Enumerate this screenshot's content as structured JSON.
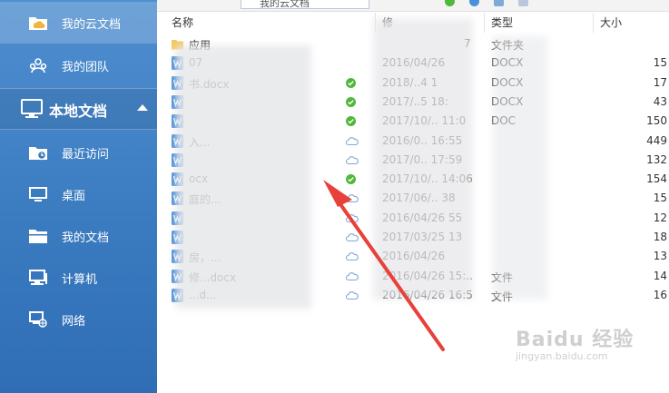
{
  "sidebar": {
    "items": [
      {
        "label": "我的云文档",
        "icon": "cloud-folder-icon"
      },
      {
        "label": "我的团队",
        "icon": "team-icon"
      }
    ],
    "section": {
      "label": "本地文档",
      "icon": "monitor-icon",
      "toggle": "collapse-arrow-icon"
    },
    "local_items": [
      {
        "label": "最近访问",
        "icon": "recent-clock-icon"
      },
      {
        "label": "桌面",
        "icon": "desktop-icon"
      },
      {
        "label": "我的文档",
        "icon": "documents-folder-icon"
      },
      {
        "label": "计算机",
        "icon": "computer-icon"
      },
      {
        "label": "网络",
        "icon": "network-icon"
      }
    ]
  },
  "toolbar": {
    "path": "我的云文档"
  },
  "columns": {
    "name": "名称",
    "modified": "修",
    "type": "类型",
    "size": "大小"
  },
  "files": [
    {
      "name": "应用",
      "icon": "folder-icon",
      "status": "",
      "date": "",
      "date_tail": "7",
      "type": "文件夹",
      "size": ""
    },
    {
      "name": "07",
      "icon": "word-doc-icon",
      "status": "",
      "date": "2016/04/26",
      "type": "DOCX",
      "size": "15"
    },
    {
      "name": "书.docx",
      "icon": "word-doc-icon",
      "status": "synced",
      "date": "2018/..4 1",
      "type": "DOCX",
      "size": "17"
    },
    {
      "name": "",
      "icon": "word-doc-icon",
      "status": "synced",
      "date": "2017/..5 18:",
      "type": "DOCX",
      "size": "43"
    },
    {
      "name": "",
      "icon": "word-doc-icon",
      "status": "synced",
      "date": "2017/10/.. 11:0",
      "type": "DOC",
      "size": "150"
    },
    {
      "name": "入...",
      "icon": "word-doc-icon",
      "status": "cloud",
      "date": "2016/0.. 16:55",
      "type": "",
      "size": "449"
    },
    {
      "name": "",
      "icon": "word-doc-icon",
      "status": "cloud",
      "date": "2017/0.. 17:59",
      "type": "",
      "size": "132"
    },
    {
      "name": "ocx",
      "icon": "word-doc-icon",
      "status": "synced",
      "date": "2017/10/.. 14:06",
      "type": "",
      "size": "154"
    },
    {
      "name": "庭的...",
      "icon": "word-doc-icon",
      "status": "cloud",
      "date": "2017/06/.. 38",
      "type": "",
      "size": "15"
    },
    {
      "name": "",
      "icon": "word-doc-icon",
      "status": "cloud",
      "date": "2016/04/26 55",
      "type": "",
      "size": "12"
    },
    {
      "name": "",
      "icon": "word-doc-icon",
      "status": "cloud",
      "date": "2017/03/25 13",
      "type": "",
      "size": "18"
    },
    {
      "name": "房，...",
      "icon": "word-doc-icon",
      "status": "cloud",
      "date": "2016/04/26",
      "type": "",
      "size": "13"
    },
    {
      "name": "修...docx",
      "icon": "word-doc-icon",
      "status": "cloud",
      "date": "2016/04/26 15:..",
      "type": "文件",
      "size": "14"
    },
    {
      "name": "...d...",
      "icon": "word-doc-icon",
      "status": "cloud",
      "date": "2016/04/26 16:5",
      "type": "文件",
      "size": "16"
    }
  ],
  "watermark": {
    "logo": "Baidu 经验",
    "url": "jingyan.baidu.com"
  },
  "colors": {
    "sidebar": "#3b7bc0",
    "synced": "#4fb83a",
    "cloud": "#7fa9d6",
    "annotation": "#e8403a"
  }
}
